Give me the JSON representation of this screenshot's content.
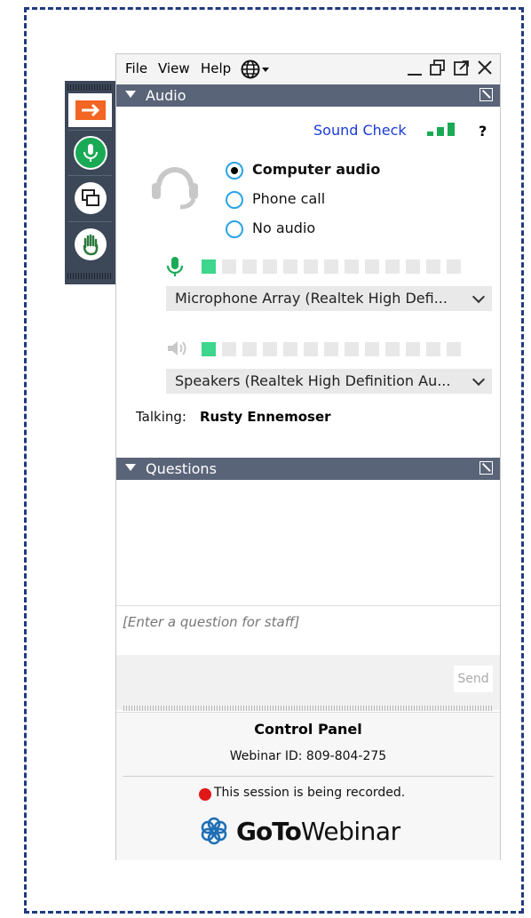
{
  "menu": {
    "file": "File",
    "view": "View",
    "help": "Help"
  },
  "sidebar": {
    "buttons": [
      {
        "name": "collapse-arrow",
        "icon": "arrow-right-icon"
      },
      {
        "name": "audio",
        "icon": "microphone-icon"
      },
      {
        "name": "screen",
        "icon": "screen-share-icon"
      },
      {
        "name": "raise-hand",
        "icon": "hand-icon"
      }
    ]
  },
  "audio": {
    "title": "Audio",
    "sound_check": "Sound Check",
    "help": "?",
    "options": [
      {
        "label": "Computer audio",
        "selected": true
      },
      {
        "label": "Phone call",
        "selected": false
      },
      {
        "label": "No audio",
        "selected": false
      }
    ],
    "microphone": {
      "level_filled": 1,
      "level_total": 13,
      "device": "Microphone Array (Realtek High Defi..."
    },
    "speakers": {
      "level_filled": 1,
      "level_total": 13,
      "device": "Speakers (Realtek High Definition Au..."
    },
    "talking_label": "Talking:",
    "talking_name": "Rusty Ennemoser"
  },
  "questions": {
    "title": "Questions",
    "placeholder": "[Enter a question for staff]",
    "send_label": "Send"
  },
  "footer": {
    "title": "Control Panel",
    "webinar_id": "Webinar ID: 809-804-275",
    "recording": "This session is being recorded.",
    "logo_goto": "GoTo",
    "logo_webinar": "Webinar"
  },
  "colors": {
    "accent": "#1a3bd6",
    "section_bar": "#5a6478",
    "mic_green": "#1aaa55",
    "meter_on": "#3dd68c",
    "record_red": "#e01818"
  }
}
